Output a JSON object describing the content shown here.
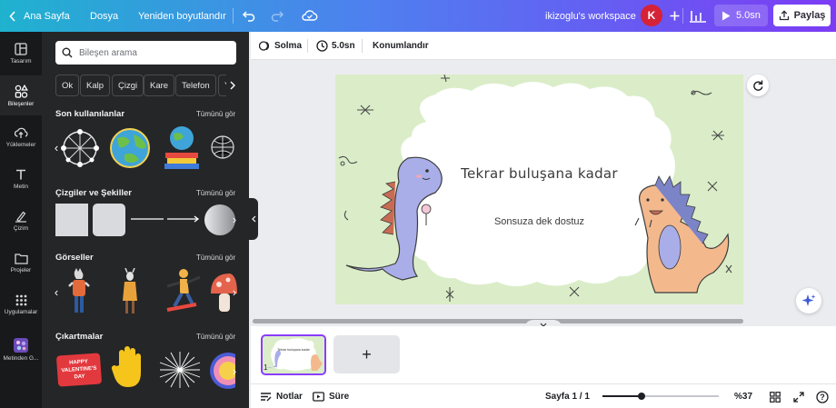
{
  "topbar": {
    "home_label": "Ana Sayfa",
    "file_label": "Dosya",
    "resize_label": "Yeniden boyutlandır",
    "workspace_label": "ikizoglu's workspace",
    "avatar_initial": "K",
    "present_label": "5.0sn",
    "share_label": "Paylaş"
  },
  "rail": {
    "items": [
      {
        "label": "Tasarım",
        "icon": "layout-icon"
      },
      {
        "label": "Bileşenler",
        "icon": "elements-icon"
      },
      {
        "label": "Yüklemeler",
        "icon": "upload-cloud-icon"
      },
      {
        "label": "Metin",
        "icon": "text-icon"
      },
      {
        "label": "Çizim",
        "icon": "pen-icon"
      },
      {
        "label": "Projeler",
        "icon": "folder-icon"
      },
      {
        "label": "Uygulamalar",
        "icon": "apps-grid-icon"
      },
      {
        "label": "Metinden G...",
        "icon": "magic-media-icon"
      }
    ]
  },
  "panel": {
    "search_placeholder": "Bileşen arama",
    "chips": [
      "Ok",
      "Kalp",
      "Çizgi",
      "Kare",
      "Telefon",
      "Yı"
    ],
    "sections": {
      "recent": {
        "title": "Son kullanılanlar",
        "see_all": "Tümünü gör"
      },
      "lines_shapes": {
        "title": "Çizgiler ve Şekiller",
        "see_all": "Tümünü gör"
      },
      "graphics": {
        "title": "Görseller",
        "see_all": "Tümünü gör"
      },
      "stickers": {
        "title": "Çıkartmalar",
        "see_all": "Tümünü gör"
      }
    },
    "sticker_text": "HAPPY VALENTINE'S DAY"
  },
  "toolbar": {
    "transition_label": "Solma",
    "duration_label": "5.0sn",
    "position_label": "Konumlandır"
  },
  "slide": {
    "title": "Tekrar buluşana kadar",
    "subtitle": "Sonsuza dek dostuz",
    "background_color": "#daedc8"
  },
  "pages": {
    "current_page_number": "1",
    "thumb_title": "Tekrar buluşana kadar",
    "add_page": "+"
  },
  "bottombar": {
    "notes_label": "Notlar",
    "duration_label": "Süre",
    "page_indicator": "Sayfa 1 / 1",
    "zoom_level": "%37",
    "zoom_fraction": 0.37,
    "help_label": "?"
  },
  "colors": {
    "accent": "#8b3dff",
    "dino_purple": "#a9aee8",
    "dino_orange": "#f3b98d",
    "spike": "#c96b54"
  }
}
